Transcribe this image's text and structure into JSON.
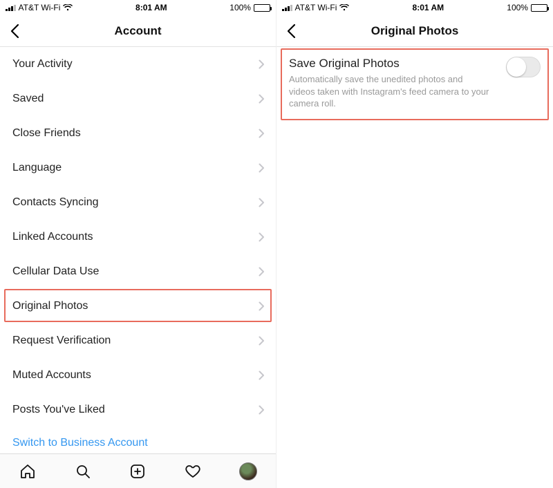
{
  "status": {
    "carrier": "AT&T Wi-Fi",
    "time": "8:01 AM",
    "battery_pct": "100%"
  },
  "left": {
    "title": "Account",
    "items": [
      "Your Activity",
      "Saved",
      "Close Friends",
      "Language",
      "Contacts Syncing",
      "Linked Accounts",
      "Cellular Data Use",
      "Original Photos",
      "Request Verification",
      "Muted Accounts",
      "Posts You've Liked"
    ],
    "highlight_index": 7,
    "switch_link": "Switch to Business Account"
  },
  "right": {
    "title": "Original Photos",
    "setting_title": "Save Original Photos",
    "setting_desc": "Automatically save the unedited photos and videos taken with Instagram's feed camera to your camera roll.",
    "toggle_on": false
  }
}
